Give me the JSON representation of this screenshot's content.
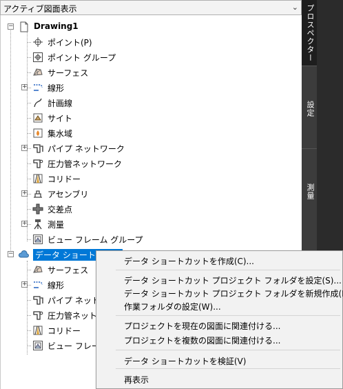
{
  "view_select": {
    "value": "アクティブ図面表示"
  },
  "side_tabs": [
    "プロスペクター",
    "設定",
    "測量"
  ],
  "tree": {
    "root": "Drawing1",
    "items": [
      {
        "label": "ポイント(P)",
        "icon": "point-icon"
      },
      {
        "label": "ポイント グループ",
        "icon": "point-group-icon"
      },
      {
        "label": "サーフェス",
        "icon": "surface-icon"
      },
      {
        "label": "線形",
        "icon": "alignment-icon"
      },
      {
        "label": "計画線",
        "icon": "feature-line-icon"
      },
      {
        "label": "サイト",
        "icon": "site-icon"
      },
      {
        "label": "集水域",
        "icon": "catchment-icon"
      },
      {
        "label": "パイプ ネットワーク",
        "icon": "pipe-network-icon"
      },
      {
        "label": "圧力管ネットワーク",
        "icon": "pressure-network-icon"
      },
      {
        "label": "コリドー",
        "icon": "corridor-icon"
      },
      {
        "label": "アセンブリ",
        "icon": "assembly-icon"
      },
      {
        "label": "交差点",
        "icon": "intersection-icon"
      },
      {
        "label": "測量",
        "icon": "survey-icon"
      },
      {
        "label": "ビュー フレーム グループ",
        "icon": "view-frame-icon"
      }
    ],
    "shortcut_node": "データ ショートカット",
    "shortcut_items": [
      {
        "label": "サーフェス",
        "icon": "surface-icon"
      },
      {
        "label": "線形",
        "icon": "alignment-icon"
      },
      {
        "label": "パイプ ネットワーク",
        "icon": "pipe-network-icon"
      },
      {
        "label": "圧力管ネットワーク",
        "icon": "pressure-network-icon"
      },
      {
        "label": "コリドー",
        "icon": "corridor-icon"
      },
      {
        "label": "ビュー フレーム グループ",
        "icon": "view-frame-icon"
      }
    ]
  },
  "context_menu": {
    "items": [
      "データ ショートカットを作成(C)...",
      "データ ショートカット プロジェクト フォルダを設定(S)...",
      "データ ショートカット プロジェクト フォルダを新規作成(N)...",
      "作業フォルダの設定(W)...",
      "プロジェクトを現在の図面に関連付ける...",
      "プロジェクトを複数の図面に関連付ける...",
      "データ ショートカットを検証(V)",
      "再表示"
    ]
  }
}
